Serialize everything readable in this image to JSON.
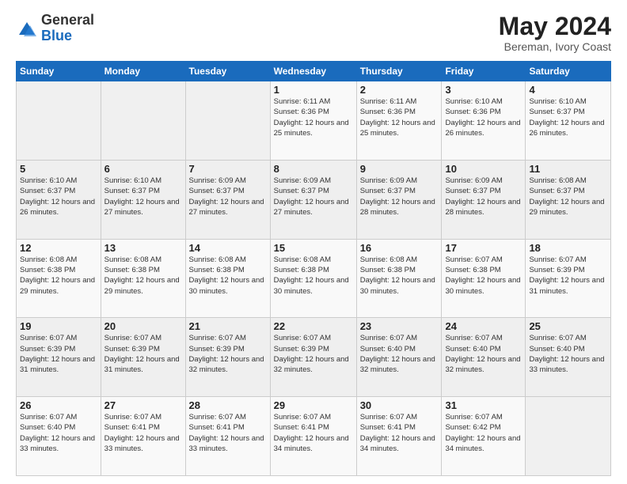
{
  "logo": {
    "general": "General",
    "blue": "Blue"
  },
  "header": {
    "month": "May 2024",
    "location": "Bereman, Ivory Coast"
  },
  "weekdays": [
    "Sunday",
    "Monday",
    "Tuesday",
    "Wednesday",
    "Thursday",
    "Friday",
    "Saturday"
  ],
  "weeks": [
    [
      {
        "day": "",
        "info": ""
      },
      {
        "day": "",
        "info": ""
      },
      {
        "day": "",
        "info": ""
      },
      {
        "day": "1",
        "info": "Sunrise: 6:11 AM\nSunset: 6:36 PM\nDaylight: 12 hours and 25 minutes."
      },
      {
        "day": "2",
        "info": "Sunrise: 6:11 AM\nSunset: 6:36 PM\nDaylight: 12 hours and 25 minutes."
      },
      {
        "day": "3",
        "info": "Sunrise: 6:10 AM\nSunset: 6:36 PM\nDaylight: 12 hours and 26 minutes."
      },
      {
        "day": "4",
        "info": "Sunrise: 6:10 AM\nSunset: 6:37 PM\nDaylight: 12 hours and 26 minutes."
      }
    ],
    [
      {
        "day": "5",
        "info": "Sunrise: 6:10 AM\nSunset: 6:37 PM\nDaylight: 12 hours and 26 minutes."
      },
      {
        "day": "6",
        "info": "Sunrise: 6:10 AM\nSunset: 6:37 PM\nDaylight: 12 hours and 27 minutes."
      },
      {
        "day": "7",
        "info": "Sunrise: 6:09 AM\nSunset: 6:37 PM\nDaylight: 12 hours and 27 minutes."
      },
      {
        "day": "8",
        "info": "Sunrise: 6:09 AM\nSunset: 6:37 PM\nDaylight: 12 hours and 27 minutes."
      },
      {
        "day": "9",
        "info": "Sunrise: 6:09 AM\nSunset: 6:37 PM\nDaylight: 12 hours and 28 minutes."
      },
      {
        "day": "10",
        "info": "Sunrise: 6:09 AM\nSunset: 6:37 PM\nDaylight: 12 hours and 28 minutes."
      },
      {
        "day": "11",
        "info": "Sunrise: 6:08 AM\nSunset: 6:37 PM\nDaylight: 12 hours and 29 minutes."
      }
    ],
    [
      {
        "day": "12",
        "info": "Sunrise: 6:08 AM\nSunset: 6:38 PM\nDaylight: 12 hours and 29 minutes."
      },
      {
        "day": "13",
        "info": "Sunrise: 6:08 AM\nSunset: 6:38 PM\nDaylight: 12 hours and 29 minutes."
      },
      {
        "day": "14",
        "info": "Sunrise: 6:08 AM\nSunset: 6:38 PM\nDaylight: 12 hours and 30 minutes."
      },
      {
        "day": "15",
        "info": "Sunrise: 6:08 AM\nSunset: 6:38 PM\nDaylight: 12 hours and 30 minutes."
      },
      {
        "day": "16",
        "info": "Sunrise: 6:08 AM\nSunset: 6:38 PM\nDaylight: 12 hours and 30 minutes."
      },
      {
        "day": "17",
        "info": "Sunrise: 6:07 AM\nSunset: 6:38 PM\nDaylight: 12 hours and 30 minutes."
      },
      {
        "day": "18",
        "info": "Sunrise: 6:07 AM\nSunset: 6:39 PM\nDaylight: 12 hours and 31 minutes."
      }
    ],
    [
      {
        "day": "19",
        "info": "Sunrise: 6:07 AM\nSunset: 6:39 PM\nDaylight: 12 hours and 31 minutes."
      },
      {
        "day": "20",
        "info": "Sunrise: 6:07 AM\nSunset: 6:39 PM\nDaylight: 12 hours and 31 minutes."
      },
      {
        "day": "21",
        "info": "Sunrise: 6:07 AM\nSunset: 6:39 PM\nDaylight: 12 hours and 32 minutes."
      },
      {
        "day": "22",
        "info": "Sunrise: 6:07 AM\nSunset: 6:39 PM\nDaylight: 12 hours and 32 minutes."
      },
      {
        "day": "23",
        "info": "Sunrise: 6:07 AM\nSunset: 6:40 PM\nDaylight: 12 hours and 32 minutes."
      },
      {
        "day": "24",
        "info": "Sunrise: 6:07 AM\nSunset: 6:40 PM\nDaylight: 12 hours and 32 minutes."
      },
      {
        "day": "25",
        "info": "Sunrise: 6:07 AM\nSunset: 6:40 PM\nDaylight: 12 hours and 33 minutes."
      }
    ],
    [
      {
        "day": "26",
        "info": "Sunrise: 6:07 AM\nSunset: 6:40 PM\nDaylight: 12 hours and 33 minutes."
      },
      {
        "day": "27",
        "info": "Sunrise: 6:07 AM\nSunset: 6:41 PM\nDaylight: 12 hours and 33 minutes."
      },
      {
        "day": "28",
        "info": "Sunrise: 6:07 AM\nSunset: 6:41 PM\nDaylight: 12 hours and 33 minutes."
      },
      {
        "day": "29",
        "info": "Sunrise: 6:07 AM\nSunset: 6:41 PM\nDaylight: 12 hours and 34 minutes."
      },
      {
        "day": "30",
        "info": "Sunrise: 6:07 AM\nSunset: 6:41 PM\nDaylight: 12 hours and 34 minutes."
      },
      {
        "day": "31",
        "info": "Sunrise: 6:07 AM\nSunset: 6:42 PM\nDaylight: 12 hours and 34 minutes."
      },
      {
        "day": "",
        "info": ""
      }
    ]
  ]
}
